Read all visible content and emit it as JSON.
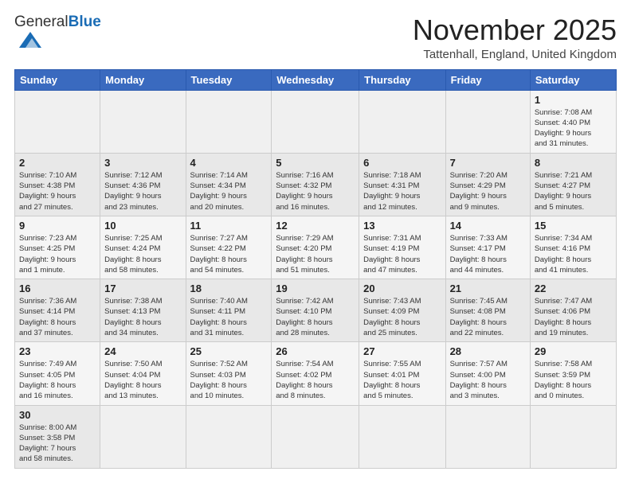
{
  "header": {
    "logo_general": "General",
    "logo_blue": "Blue",
    "month_title": "November 2025",
    "location": "Tattenhall, England, United Kingdom"
  },
  "weekdays": [
    "Sunday",
    "Monday",
    "Tuesday",
    "Wednesday",
    "Thursday",
    "Friday",
    "Saturday"
  ],
  "weeks": [
    [
      {
        "day": "",
        "info": ""
      },
      {
        "day": "",
        "info": ""
      },
      {
        "day": "",
        "info": ""
      },
      {
        "day": "",
        "info": ""
      },
      {
        "day": "",
        "info": ""
      },
      {
        "day": "",
        "info": ""
      },
      {
        "day": "1",
        "info": "Sunrise: 7:08 AM\nSunset: 4:40 PM\nDaylight: 9 hours\nand 31 minutes."
      }
    ],
    [
      {
        "day": "2",
        "info": "Sunrise: 7:10 AM\nSunset: 4:38 PM\nDaylight: 9 hours\nand 27 minutes."
      },
      {
        "day": "3",
        "info": "Sunrise: 7:12 AM\nSunset: 4:36 PM\nDaylight: 9 hours\nand 23 minutes."
      },
      {
        "day": "4",
        "info": "Sunrise: 7:14 AM\nSunset: 4:34 PM\nDaylight: 9 hours\nand 20 minutes."
      },
      {
        "day": "5",
        "info": "Sunrise: 7:16 AM\nSunset: 4:32 PM\nDaylight: 9 hours\nand 16 minutes."
      },
      {
        "day": "6",
        "info": "Sunrise: 7:18 AM\nSunset: 4:31 PM\nDaylight: 9 hours\nand 12 minutes."
      },
      {
        "day": "7",
        "info": "Sunrise: 7:20 AM\nSunset: 4:29 PM\nDaylight: 9 hours\nand 9 minutes."
      },
      {
        "day": "8",
        "info": "Sunrise: 7:21 AM\nSunset: 4:27 PM\nDaylight: 9 hours\nand 5 minutes."
      }
    ],
    [
      {
        "day": "9",
        "info": "Sunrise: 7:23 AM\nSunset: 4:25 PM\nDaylight: 9 hours\nand 1 minute."
      },
      {
        "day": "10",
        "info": "Sunrise: 7:25 AM\nSunset: 4:24 PM\nDaylight: 8 hours\nand 58 minutes."
      },
      {
        "day": "11",
        "info": "Sunrise: 7:27 AM\nSunset: 4:22 PM\nDaylight: 8 hours\nand 54 minutes."
      },
      {
        "day": "12",
        "info": "Sunrise: 7:29 AM\nSunset: 4:20 PM\nDaylight: 8 hours\nand 51 minutes."
      },
      {
        "day": "13",
        "info": "Sunrise: 7:31 AM\nSunset: 4:19 PM\nDaylight: 8 hours\nand 47 minutes."
      },
      {
        "day": "14",
        "info": "Sunrise: 7:33 AM\nSunset: 4:17 PM\nDaylight: 8 hours\nand 44 minutes."
      },
      {
        "day": "15",
        "info": "Sunrise: 7:34 AM\nSunset: 4:16 PM\nDaylight: 8 hours\nand 41 minutes."
      }
    ],
    [
      {
        "day": "16",
        "info": "Sunrise: 7:36 AM\nSunset: 4:14 PM\nDaylight: 8 hours\nand 37 minutes."
      },
      {
        "day": "17",
        "info": "Sunrise: 7:38 AM\nSunset: 4:13 PM\nDaylight: 8 hours\nand 34 minutes."
      },
      {
        "day": "18",
        "info": "Sunrise: 7:40 AM\nSunset: 4:11 PM\nDaylight: 8 hours\nand 31 minutes."
      },
      {
        "day": "19",
        "info": "Sunrise: 7:42 AM\nSunset: 4:10 PM\nDaylight: 8 hours\nand 28 minutes."
      },
      {
        "day": "20",
        "info": "Sunrise: 7:43 AM\nSunset: 4:09 PM\nDaylight: 8 hours\nand 25 minutes."
      },
      {
        "day": "21",
        "info": "Sunrise: 7:45 AM\nSunset: 4:08 PM\nDaylight: 8 hours\nand 22 minutes."
      },
      {
        "day": "22",
        "info": "Sunrise: 7:47 AM\nSunset: 4:06 PM\nDaylight: 8 hours\nand 19 minutes."
      }
    ],
    [
      {
        "day": "23",
        "info": "Sunrise: 7:49 AM\nSunset: 4:05 PM\nDaylight: 8 hours\nand 16 minutes."
      },
      {
        "day": "24",
        "info": "Sunrise: 7:50 AM\nSunset: 4:04 PM\nDaylight: 8 hours\nand 13 minutes."
      },
      {
        "day": "25",
        "info": "Sunrise: 7:52 AM\nSunset: 4:03 PM\nDaylight: 8 hours\nand 10 minutes."
      },
      {
        "day": "26",
        "info": "Sunrise: 7:54 AM\nSunset: 4:02 PM\nDaylight: 8 hours\nand 8 minutes."
      },
      {
        "day": "27",
        "info": "Sunrise: 7:55 AM\nSunset: 4:01 PM\nDaylight: 8 hours\nand 5 minutes."
      },
      {
        "day": "28",
        "info": "Sunrise: 7:57 AM\nSunset: 4:00 PM\nDaylight: 8 hours\nand 3 minutes."
      },
      {
        "day": "29",
        "info": "Sunrise: 7:58 AM\nSunset: 3:59 PM\nDaylight: 8 hours\nand 0 minutes."
      }
    ],
    [
      {
        "day": "30",
        "info": "Sunrise: 8:00 AM\nSunset: 3:58 PM\nDaylight: 7 hours\nand 58 minutes."
      },
      {
        "day": "",
        "info": ""
      },
      {
        "day": "",
        "info": ""
      },
      {
        "day": "",
        "info": ""
      },
      {
        "day": "",
        "info": ""
      },
      {
        "day": "",
        "info": ""
      },
      {
        "day": "",
        "info": ""
      }
    ]
  ]
}
